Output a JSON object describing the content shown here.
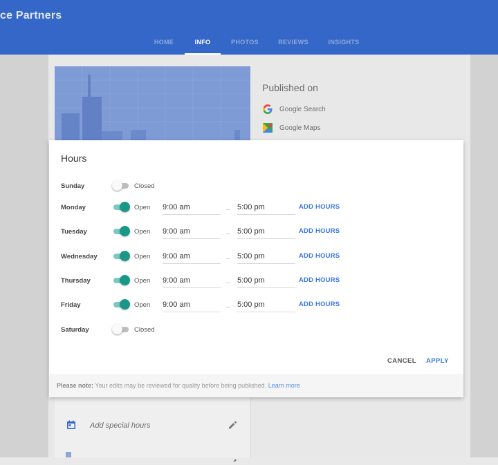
{
  "header": {
    "business_name": "ce Partners",
    "tabs": [
      {
        "label": "HOME",
        "active": false
      },
      {
        "label": "INFO",
        "active": true
      },
      {
        "label": "PHOTOS",
        "active": false
      },
      {
        "label": "REVIEWS",
        "active": false
      },
      {
        "label": "INSIGHTS",
        "active": false
      }
    ]
  },
  "published": {
    "title": "Published on",
    "items": [
      {
        "label": "Google Search",
        "icon": "google-g-icon"
      },
      {
        "label": "Google Maps",
        "icon": "google-maps-icon"
      }
    ]
  },
  "info_card": {
    "special_hours_label": "Add special hours"
  },
  "dialog": {
    "title": "Hours",
    "days": [
      {
        "name": "Sunday",
        "open": false,
        "status": "Closed"
      },
      {
        "name": "Monday",
        "open": true,
        "status": "Open",
        "open_time": "9:00 am",
        "close_time": "5:00 pm",
        "add_label": "ADD HOURS"
      },
      {
        "name": "Tuesday",
        "open": true,
        "status": "Open",
        "open_time": "9:00 am",
        "close_time": "5:00 pm",
        "add_label": "ADD HOURS"
      },
      {
        "name": "Wednesday",
        "open": true,
        "status": "Open",
        "open_time": "9:00 am",
        "close_time": "5:00 pm",
        "add_label": "ADD HOURS"
      },
      {
        "name": "Thursday",
        "open": true,
        "status": "Open",
        "open_time": "9:00 am",
        "close_time": "5:00 pm",
        "add_label": "ADD HOURS"
      },
      {
        "name": "Friday",
        "open": true,
        "status": "Open",
        "open_time": "9:00 am",
        "close_time": "5:00 pm",
        "add_label": "ADD HOURS"
      },
      {
        "name": "Saturday",
        "open": false,
        "status": "Closed"
      }
    ],
    "cancel_label": "CANCEL",
    "apply_label": "APPLY",
    "note_bold": "Please note:",
    "note_text": " Your edits may be reviewed for quality before being published. ",
    "note_link": "Learn more"
  },
  "colors": {
    "header_blue": "#3567c8",
    "toggle_on": "#19988a",
    "link_blue": "#3b78e7"
  }
}
